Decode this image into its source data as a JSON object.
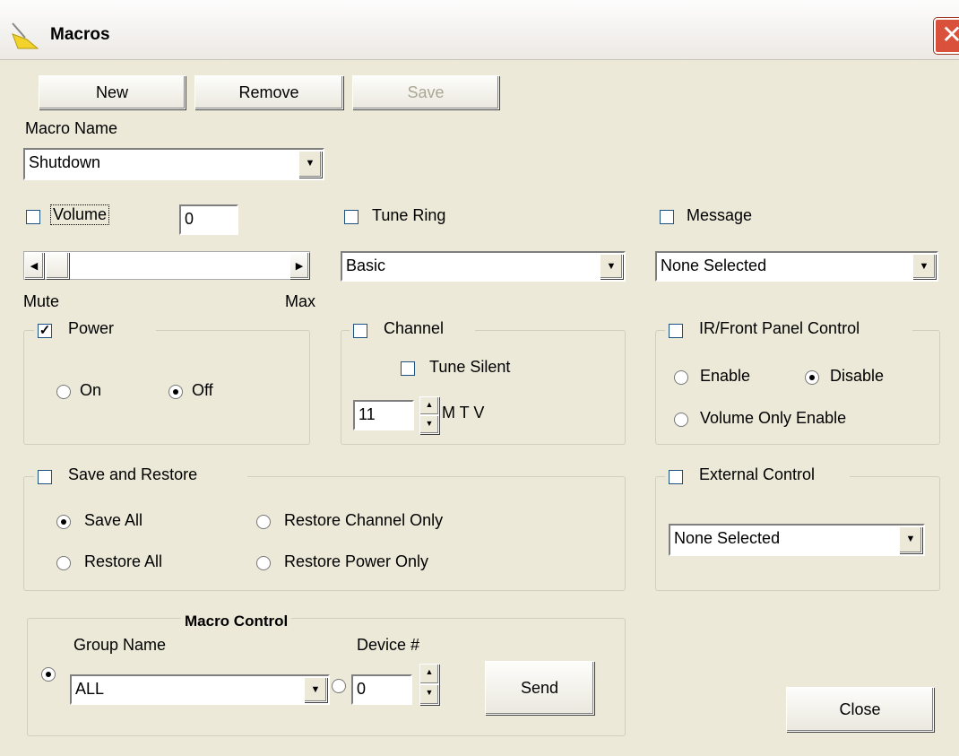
{
  "window": {
    "title": "Macros",
    "close_glyph": "✕"
  },
  "toolbar": {
    "new_label": "New",
    "remove_label": "Remove",
    "save_label": "Save"
  },
  "macro_name": {
    "label": "Macro Name",
    "value": "Shutdown"
  },
  "volume": {
    "label": "Volume",
    "checked": false,
    "value": "0",
    "min_label": "Mute",
    "max_label": "Max"
  },
  "tune_ring": {
    "label": "Tune Ring",
    "checked": false,
    "value": "Basic"
  },
  "message": {
    "label": "Message",
    "checked": false,
    "value": "None Selected"
  },
  "power": {
    "label": "Power",
    "checked": true,
    "on_label": "On",
    "off_label": "Off",
    "selected": "Off"
  },
  "channel": {
    "label": "Channel",
    "checked": false,
    "tune_silent_label": "Tune Silent",
    "value": "11",
    "name": "M T V"
  },
  "ir_panel": {
    "label": "IR/Front Panel Control",
    "checked": false,
    "enable_label": "Enable",
    "disable_label": "Disable",
    "volume_only_label": "Volume Only Enable",
    "selected": "Disable"
  },
  "save_restore": {
    "label": "Save and Restore",
    "checked": false,
    "save_all_label": "Save All",
    "restore_channel_label": "Restore Channel Only",
    "restore_all_label": "Restore All",
    "restore_power_label": "Restore Power Only",
    "selected": "Save All"
  },
  "external_control": {
    "label": "External Control",
    "checked": false,
    "value": "None Selected"
  },
  "macro_control": {
    "title": "Macro Control",
    "group_name_label": "Group Name",
    "group_value": "ALL",
    "device_label": "Device #",
    "device_value": "0",
    "send_label": "Send",
    "selected": "group"
  },
  "footer": {
    "close_label": "Close"
  },
  "colors": {
    "dialog_bg": "#ece9d8",
    "close_button": "#d9513b"
  }
}
